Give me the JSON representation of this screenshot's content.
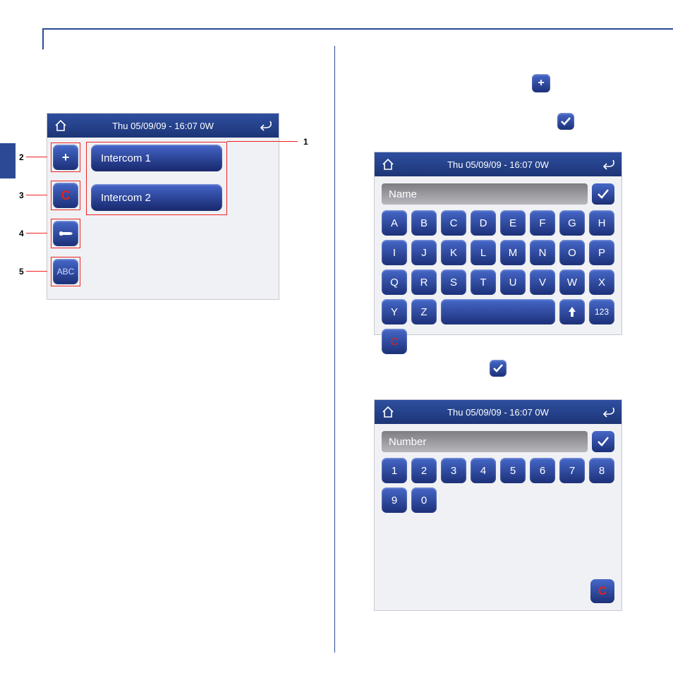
{
  "header_datetime": "Thu 05/09/09 - 16:07   0W",
  "left_panel": {
    "intercom1": "Intercom 1",
    "intercom2": "Intercom 2",
    "side_buttons": {
      "plus": "+",
      "clear": "C",
      "abc": "ABC"
    },
    "callouts": {
      "c1": "1",
      "c2": "2",
      "c3": "3",
      "c4": "4",
      "c5": "5"
    }
  },
  "alpha_panel": {
    "input_placeholder": "Name",
    "keys_row1": [
      "A",
      "B",
      "C",
      "D",
      "E",
      "F",
      "G",
      "H"
    ],
    "keys_row2": [
      "I",
      "J",
      "K",
      "L",
      "M",
      "N",
      "O",
      "P"
    ],
    "keys_row3": [
      "Q",
      "R",
      "S",
      "T",
      "U",
      "V",
      "W",
      "X"
    ],
    "keys_row4_a": [
      "Y",
      "Z"
    ],
    "clear": "C",
    "numswitch": "123"
  },
  "num_panel": {
    "input_placeholder": "Number",
    "keys": [
      "1",
      "2",
      "3",
      "4",
      "5",
      "6",
      "7",
      "8",
      "9",
      "0"
    ],
    "clear": "C"
  },
  "float_plus": "+"
}
